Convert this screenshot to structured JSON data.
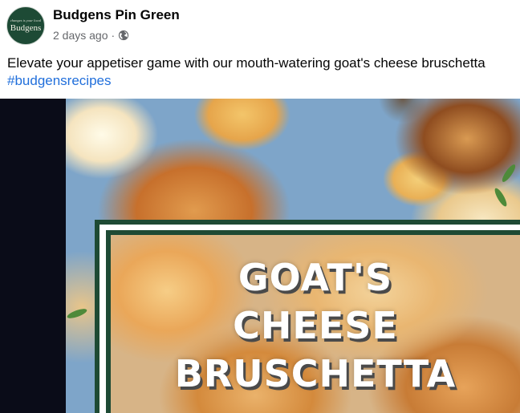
{
  "post": {
    "page_name": "Budgens Pin Green",
    "timestamp": "2 days ago",
    "separator": "·",
    "audience_icon": "globe-icon",
    "caption": "Elevate your appetiser game with our mouth-watering goat's cheese bruschetta",
    "hashtag": "#budgensrecipes"
  },
  "avatar": {
    "tagline": "changes is your local",
    "brand": "Budgens"
  },
  "video": {
    "title_lines": [
      "GOAT'S",
      "CHEESE",
      "BRUSCHETTA"
    ]
  },
  "colors": {
    "brand_green": "#1e4a34",
    "link_blue": "#216fdb",
    "meta_grey": "#65676b"
  }
}
